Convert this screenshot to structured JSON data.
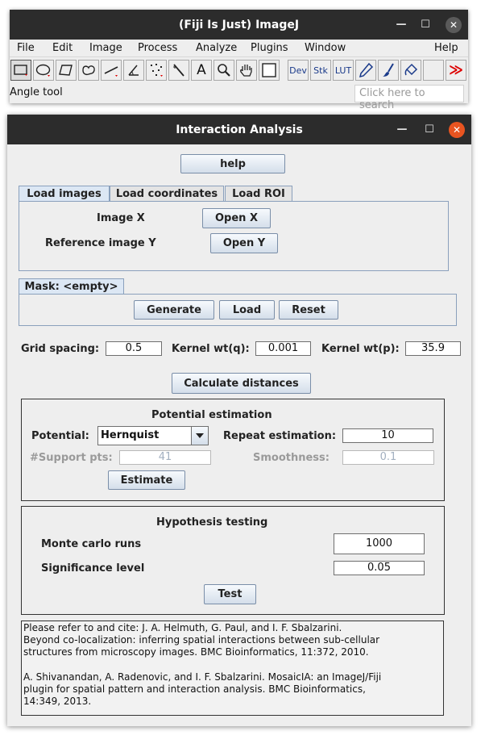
{
  "imagej": {
    "title": "(Fiji Is Just) ImageJ",
    "menus": [
      "File",
      "Edit",
      "Image",
      "Process",
      "Analyze",
      "Plugins",
      "Window",
      "Help"
    ],
    "tools": [
      "rectangle-tool",
      "oval-tool",
      "polygon-tool",
      "freehand-tool",
      "line-tool",
      "angle-tool",
      "multipoint-tool",
      "wand-tool",
      "text-tool",
      "magnifier-tool",
      "hand-tool",
      "color-picker-tool",
      "dev-menu",
      "stk-menu",
      "lut-menu",
      "pencil-tool",
      "brush-tool",
      "flood-fill-tool",
      "more-tools"
    ],
    "tool_text": {
      "text": "A",
      "dev": "Dev",
      "stk": "Stk",
      "lut": "LUT",
      "more": "≫"
    },
    "status": "Angle tool",
    "search_placeholder": "Click here to search"
  },
  "dialog": {
    "title": "Interaction Analysis",
    "help_button": "help",
    "tabs": [
      "Load images",
      "Load coordinates",
      "Load ROI"
    ],
    "active_tab": "Load images",
    "image_x_label": "Image X",
    "open_x_button": "Open X",
    "ref_y_label": "Reference image Y",
    "open_y_button": "Open Y",
    "mask_tab": "Mask: <empty>",
    "generate_button": "Generate",
    "load_button": "Load",
    "reset_button": "Reset",
    "grid_spacing_label": "Grid spacing:",
    "grid_spacing_value": "0.5",
    "kernel_q_label": "Kernel wt(q):",
    "kernel_q_value": "0.001",
    "kernel_p_label": "Kernel wt(p):",
    "kernel_p_value": "35.9",
    "calc_button": "Calculate distances",
    "potential": {
      "heading": "Potential estimation",
      "potential_label": "Potential:",
      "potential_value": "Hernquist",
      "repeat_label": "Repeat estimation:",
      "repeat_value": "10",
      "support_label": "#Support pts:",
      "support_value": "41",
      "smoothness_label": "Smoothness:",
      "smoothness_value": "0.1",
      "estimate_button": "Estimate"
    },
    "hypothesis": {
      "heading": "Hypothesis testing",
      "mc_label": "Monte carlo runs",
      "mc_value": "1000",
      "sig_label": "Significance level",
      "sig_value": "0.05",
      "test_button": "Test"
    },
    "references": "Please refer to and cite: J. A. Helmuth, G. Paul, and I. F. Sbalzarini.\nBeyond co-localization: inferring spatial interactions between sub-cellular\nstructures from microscopy images. BMC Bioinformatics, 11:372, 2010.\n\nA. Shivanandan, A. Radenovic, and I. F. Sbalzarini. MosaicIA: an ImageJ/Fiji\nplugin for spatial pattern and interaction analysis. BMC Bioinformatics,\n14:349, 2013."
  },
  "colors": {
    "titlebar": "#2c2c2c",
    "close_orange": "#e95420",
    "panel_border": "#8aa0bc"
  }
}
